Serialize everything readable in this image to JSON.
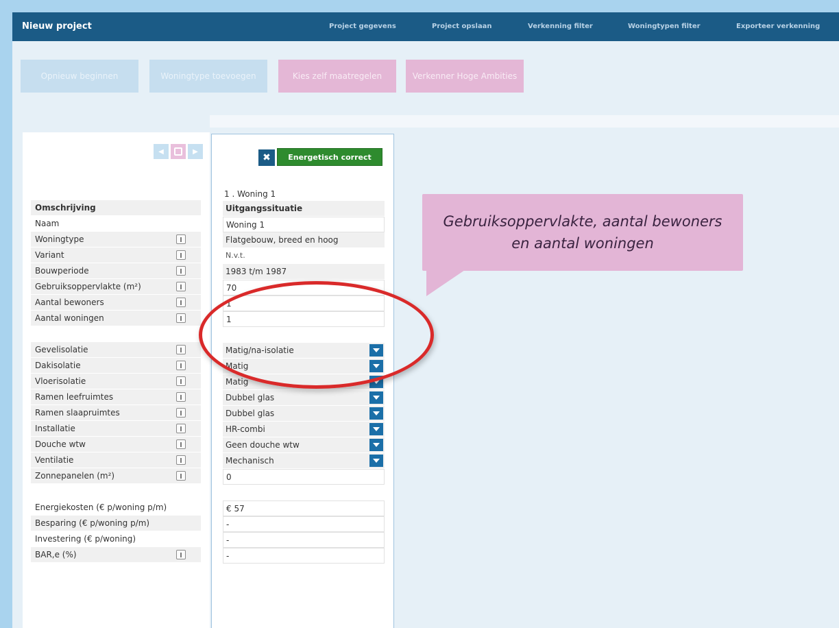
{
  "header": {
    "app_title": "Nieuw project",
    "nav": [
      "Project gegevens",
      "Project opslaan",
      "Verkenning filter",
      "Woningtypen filter",
      "Exporteer verkenning"
    ]
  },
  "actions": [
    {
      "label": "Opnieuw beginnen",
      "style": "blue"
    },
    {
      "label": "Woningtype toevoegen",
      "style": "blue"
    },
    {
      "label": "Kies zelf maatregelen",
      "style": "pink"
    },
    {
      "label": "Verkenner Hoge Ambities",
      "style": "pink"
    }
  ],
  "pager": {
    "prev": "◀",
    "next": "▶"
  },
  "column": {
    "close_label": "✖",
    "status_button": "Energetisch correct",
    "title": "1 . Woning 1"
  },
  "rows": [
    {
      "label": "Omschrijving",
      "value": "Uitgangssituatie",
      "bold": true
    },
    {
      "label": "Naam",
      "value": "Woning 1"
    },
    {
      "label": "Woningtype",
      "value": "Flatgebouw, breed en hoog",
      "info": true
    },
    {
      "label": "Variant",
      "value": "N.v.t.",
      "info": true
    },
    {
      "label": "Bouwperiode",
      "value": "1983 t/m 1987",
      "info": true
    },
    {
      "label": "Gebruiksoppervlakte (m²)",
      "value": "70",
      "info": true
    },
    {
      "label": "Aantal bewoners",
      "value": "1",
      "info": true
    },
    {
      "label": "Aantal woningen",
      "value": "1",
      "info": true
    },
    {
      "label": "Gevelisolatie",
      "value": "Matig/na-isolatie",
      "info": true
    },
    {
      "label": "Dakisolatie",
      "value": "Matig",
      "info": true
    },
    {
      "label": "Vloerisolatie",
      "value": "Matig",
      "info": true
    },
    {
      "label": "Ramen leefruimtes",
      "value": "Dubbel glas",
      "info": true
    },
    {
      "label": "Ramen slaapruimtes",
      "value": "Dubbel glas",
      "info": true
    },
    {
      "label": "Installatie",
      "value": "HR-combi",
      "info": true
    },
    {
      "label": "Douche wtw",
      "value": "Geen douche wtw",
      "info": true
    },
    {
      "label": "Ventilatie",
      "value": "Mechanisch",
      "info": true
    },
    {
      "label": "Zonnepanelen (m²)",
      "value": "0",
      "info": true
    },
    {
      "label": "Energiekosten (€ p/woning p/m)",
      "value": "€ 57"
    },
    {
      "label": "Besparing (€ p/woning p/m)",
      "value": "-"
    },
    {
      "label": "Investering (€ p/woning)",
      "value": "-"
    },
    {
      "label": "BAR,e (%)",
      "value": "-",
      "info": true
    }
  ],
  "callout": {
    "text": "Gebruiksoppervlakte, aantal bewoners en aantal woningen",
    "color": "#e3b5d6"
  },
  "colors": {
    "brand": "#1b5b86",
    "success": "#2e8b2e",
    "highlight": "#d92a2a"
  }
}
